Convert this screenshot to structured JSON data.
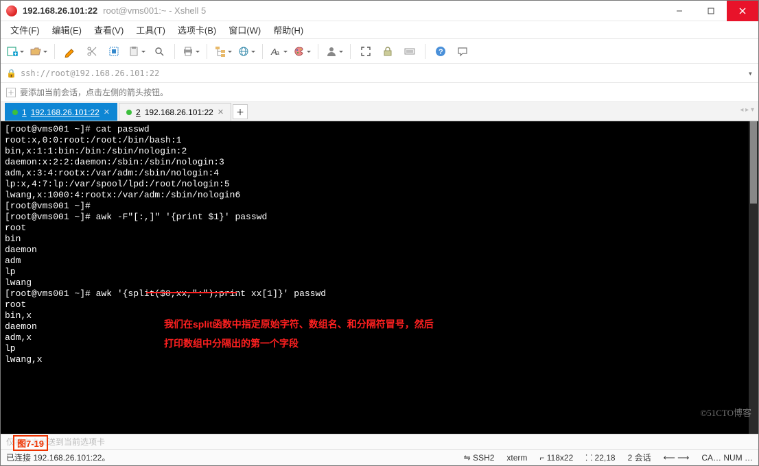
{
  "title": {
    "host": "192.168.26.101:22",
    "rest": "root@vms001:~ - Xshell 5"
  },
  "menu": [
    "文件(F)",
    "编辑(E)",
    "查看(V)",
    "工具(T)",
    "选项卡(B)",
    "窗口(W)",
    "帮助(H)"
  ],
  "toolbar_icons": [
    "new-tab",
    "open",
    "pencil",
    "scissors",
    "props",
    "clipboard",
    "search",
    "printer",
    "folder-tree",
    "globe",
    "font",
    "palette",
    "user",
    "fullscreen",
    "lock",
    "keyboard",
    "question",
    "chat"
  ],
  "addr": "ssh://root@192.168.26.101:22",
  "hint": "要添加当前会话，点击左侧的箭头按钮。",
  "tabs": [
    {
      "num": "1",
      "label": "192.168.26.101:22",
      "active": true
    },
    {
      "num": "2",
      "label": "192.168.26.101:22",
      "active": false
    }
  ],
  "terminal_lines": [
    "[root@vms001 ~]# cat passwd",
    "root:x,0:0:root:/root:/bin/bash:1",
    "bin,x:1:1:bin:/bin:/sbin/nologin:2",
    "daemon:x:2:2:daemon:/sbin:/sbin/nologin:3",
    "adm,x:3:4:rootx:/var/adm:/sbin/nologin:4",
    "lp:x,4:7:lp:/var/spool/lpd:/root/nologin:5",
    "lwang,x:1000:4:rootx:/var/adm:/sbin/nologin6",
    "[root@vms001 ~]#",
    "[root@vms001 ~]# awk -F\"[:,]\" '{print $1}' passwd",
    "root",
    "bin",
    "daemon",
    "adm",
    "lp",
    "lwang",
    "[root@vms001 ~]# awk '{split($0,xx,\":\");print xx[1]}' passwd",
    "root",
    "bin,x",
    "daemon",
    "adm,x",
    "lp",
    "lwang,x"
  ],
  "annotation_line1": "我们在split函数中指定原始字符、数组名、和分隔符冒号，然后",
  "annotation_line2": "打印数组中分隔出的第一个字段",
  "input_prompt": "仅将文本发送到当前选项卡",
  "figure_label": "图7-19",
  "status": {
    "left": "已连接 192.168.26.101:22。",
    "proto": "⇋ SSH2",
    "term": "xterm",
    "size": "⌐ 118x22",
    "pos": "⸬ 22,18",
    "sess": "2 会话",
    "extra": "⟵  ⟶",
    "right": "CA…  NUM  …"
  },
  "watermark": "©51CTO博客"
}
